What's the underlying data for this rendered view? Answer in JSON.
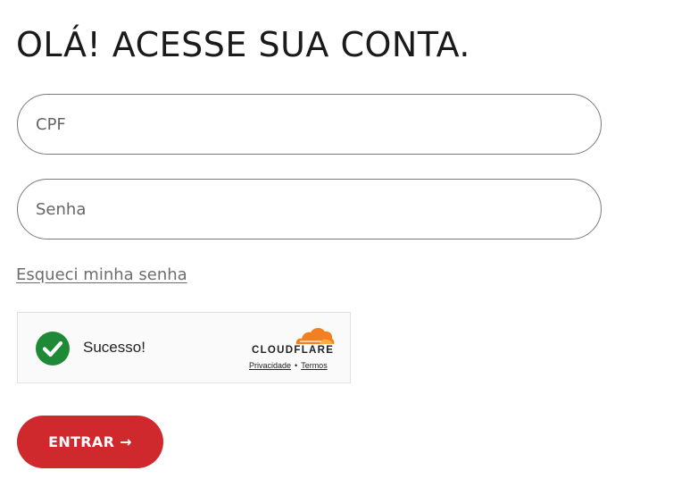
{
  "login": {
    "title": "OLÁ! ACESSE SUA CONTA.",
    "cpf_placeholder": "CPF",
    "senha_placeholder": "Senha",
    "forgot_link": "Esqueci minha senha",
    "submit_label": "ENTRAR →"
  },
  "turnstile": {
    "status_text": "Sucesso!",
    "status_icon": "check-circle-icon",
    "brand": "CLOUDFLARE",
    "privacy_link": "Privacidade",
    "separator": "•",
    "terms_link": "Termos"
  },
  "colors": {
    "accent": "#cf282d",
    "success": "#1e8a36",
    "cloudflare_orange": "#f38020"
  }
}
